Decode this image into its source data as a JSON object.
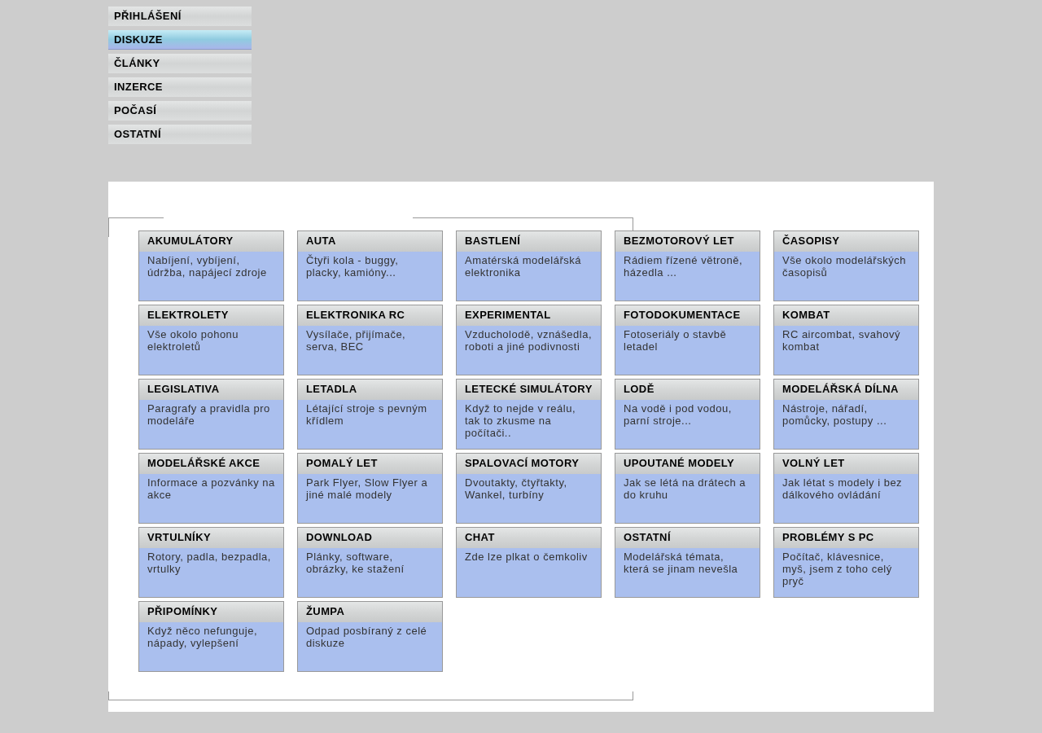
{
  "menu": [
    {
      "label": "PŘIHLÁŠENÍ",
      "selected": false
    },
    {
      "label": "DISKUZE",
      "selected": true
    },
    {
      "label": "ČLÁNKY",
      "selected": false
    },
    {
      "label": "INZERCE",
      "selected": false
    },
    {
      "label": "POČASÍ",
      "selected": false
    },
    {
      "label": "OSTATNÍ",
      "selected": false
    }
  ],
  "forums": [
    {
      "title": "AKUMULÁTORY",
      "description": "Nabíjení, vybíjení, údržba, napájecí zdroje"
    },
    {
      "title": "AUTA",
      "description": "Čtyři kola - buggy, placky, kamióny..."
    },
    {
      "title": "BASTLENÍ",
      "description": "Amatérská modelářská elektronika"
    },
    {
      "title": "BEZMOTOROVÝ LET",
      "description": "Rádiem řízené větroně, házedla ..."
    },
    {
      "title": "ČASOPISY",
      "description": "Vše okolo modelářských časopisů"
    },
    {
      "title": "ELEKTROLETY",
      "description": "Vše okolo pohonu elektroletů"
    },
    {
      "title": "ELEKTRONIKA RC",
      "description": "Vysílače, přijímače, serva, BEC"
    },
    {
      "title": "EXPERIMENTAL",
      "description": "Vzducholodě, vznášedla, roboti a jiné podivnosti"
    },
    {
      "title": "FOTODOKUMENTACE",
      "description": "Fotoseriály o stavbě letadel"
    },
    {
      "title": "KOMBAT",
      "description": "RC aircombat, svahový kombat"
    },
    {
      "title": "LEGISLATIVA",
      "description": "Paragrafy a pravidla pro modeláře"
    },
    {
      "title": "LETADLA",
      "description": "Létající stroje s pevným křídlem"
    },
    {
      "title": "LETECKÉ SIMULÁTORY",
      "description": "Když to nejde v reálu, tak to zkusme na počítači.."
    },
    {
      "title": "LODĚ",
      "description": "Na vodě i pod vodou, parní stroje..."
    },
    {
      "title": "MODELÁŘSKÁ DÍLNA",
      "description": "Nástroje, nářadí, pomůcky, postupy ..."
    },
    {
      "title": "MODELÁŘSKÉ AKCE",
      "description": "Informace a pozvánky na akce"
    },
    {
      "title": "POMALÝ LET",
      "description": "Park Flyer, Slow Flyer a jiné malé modely"
    },
    {
      "title": "SPALOVACÍ MOTORY",
      "description": "Dvoutakty, čtyřtakty, Wankel, turbíny"
    },
    {
      "title": "UPOUTANÉ MODELY",
      "description": "Jak se létá na drátech a do kruhu"
    },
    {
      "title": "VOLNÝ LET",
      "description": "Jak létat s modely i bez dálkového ovládání"
    },
    {
      "title": "VRTULNÍKY",
      "description": "Rotory, padla, bezpadla, vrtulky"
    },
    {
      "title": "DOWNLOAD",
      "description": "Plánky, software, obrázky, ke stažení"
    },
    {
      "title": "CHAT",
      "description": "Zde lze plkat o čemkoliv"
    },
    {
      "title": "OSTATNÍ",
      "description": "Modelářská témata, která se jinam nevešla"
    },
    {
      "title": "PROBLÉMY S PC",
      "description": "Počítač, klávesnice, myš, jsem z toho celý pryč"
    },
    {
      "title": "PŘIPOMÍNKY",
      "description": "Když něco nefunguje, nápady, vylepšení"
    },
    {
      "title": "ŽUMPA",
      "description": "Odpad posbíraný z celé diskuze"
    }
  ]
}
